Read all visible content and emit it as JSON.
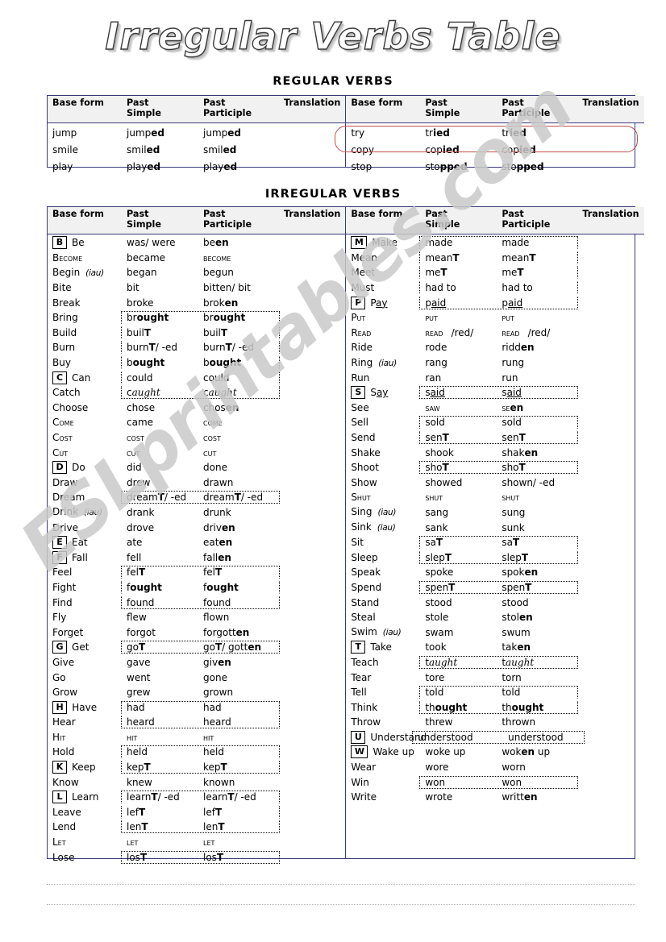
{
  "title": "Irregular Verbs Table",
  "watermark": "ESLprintables.com",
  "headings": {
    "regular": "REGULAR VERBS",
    "irregular": "IRREGULAR VERBS"
  },
  "columns": {
    "base": "Base form",
    "past_simple": "Past\nSimple",
    "past_participle": "Past\nParticiple",
    "translation": "Translation"
  },
  "regular": {
    "left": [
      {
        "base": "jump",
        "ps": "jump",
        "ps_b": "ed",
        "pp": "jump",
        "pp_b": "ed",
        "tr": ""
      },
      {
        "base": "smile",
        "ps": "smil",
        "ps_b": "ed",
        "pp": "smil",
        "pp_b": "ed",
        "tr": ""
      },
      {
        "base": "play",
        "ps": "play",
        "ps_b": "ed",
        "pp": "play",
        "pp_b": "ed",
        "tr": ""
      }
    ],
    "right": [
      {
        "base": "try",
        "ps": "tr",
        "ps_b": "ied",
        "pp": "tr",
        "pp_b": "ied",
        "tr": ""
      },
      {
        "base": "copy",
        "ps": "cop",
        "ps_b": "ied",
        "pp": "cop",
        "pp_b": "ied",
        "tr": ""
      },
      {
        "base": "stop",
        "ps": "sto",
        "ps_b": "pped",
        "pp": "sto",
        "pp_b": "pped",
        "tr": ""
      }
    ],
    "highlight_color": "#c0504d"
  },
  "irregular": {
    "left": [
      {
        "letter": "B",
        "base": "Be",
        "ps": "was/ were",
        "pp": "be",
        "pp_b": "en"
      },
      {
        "base": "Become",
        "base_sc": true,
        "ps": "became",
        "pp": "become",
        "pp_sc": true
      },
      {
        "base": "Begin",
        "note": "(iau)",
        "ps": "began",
        "pp": "begun"
      },
      {
        "base": "Bite",
        "ps": "bit",
        "pp": "bitten/ bit"
      },
      {
        "base": "Break",
        "ps": "broke",
        "pp": "brok",
        "pp_b": "en"
      },
      {
        "base": "Bring",
        "box": "top",
        "ps": "br",
        "ps_b2": "ought",
        "pp": "br",
        "pp_b2": "ought"
      },
      {
        "base": "Build",
        "box": "mid",
        "ps": "buil",
        "ps_b": "T",
        "pp": "buil",
        "pp_b": "T"
      },
      {
        "base": "Burn",
        "box": "mid",
        "ps": "burn",
        "ps_b": "T",
        "ps_tail": "/ -ed",
        "pp": "burn",
        "pp_b": "T",
        "pp_tail": "/ -ed"
      },
      {
        "base": "Buy",
        "box": "mid",
        "ps": "b",
        "ps_b2": "ought",
        "pp": "b",
        "pp_b2": "ought"
      },
      {
        "letter": "C",
        "base": "Can",
        "box": "mid",
        "ps": "could",
        "pp": "could"
      },
      {
        "base": "Catch",
        "box": "bottom",
        "ps": "c",
        "ps_script": "aught",
        "pp": "c",
        "pp_script": "aught"
      },
      {
        "base": "Choose",
        "ps": "chose",
        "pp": "chos",
        "pp_b": "en"
      },
      {
        "base": "Come",
        "base_sc": true,
        "ps": "came",
        "pp": "come",
        "pp_sc": true
      },
      {
        "base": "Cost",
        "base_sc": true,
        "ps": "cost",
        "ps_sc": true,
        "pp": "cost",
        "pp_sc": true
      },
      {
        "base": "Cut",
        "base_sc": true,
        "ps": "cut",
        "ps_sc": true,
        "pp": "cut",
        "pp_sc": true
      },
      {
        "letter": "D",
        "base": "Do",
        "ps": "did",
        "pp": "done"
      },
      {
        "base": "Draw",
        "ps": "drew",
        "pp": "drawn"
      },
      {
        "base": "Dream",
        "box": "single",
        "ps": "dream",
        "ps_b": "T",
        "ps_tail": "/ -ed",
        "pp": "dream",
        "pp_b": "T",
        "pp_tail": "/ -ed"
      },
      {
        "base": "Drink",
        "note": "(iau)",
        "ps": "drank",
        "pp": "drunk"
      },
      {
        "base": "Drive",
        "ps": "drove",
        "pp": "driv",
        "pp_b": "en"
      },
      {
        "letter": "E",
        "base": "Eat",
        "ps": "ate",
        "pp": "eat",
        "pp_b": "en"
      },
      {
        "letter": "F",
        "base": "Fall",
        "ps": "fell",
        "pp": "fall",
        "pp_b": "en"
      },
      {
        "base": "Feel",
        "box": "top",
        "ps": "fel",
        "ps_b": "T",
        "pp": "fel",
        "pp_b": "T"
      },
      {
        "base": "Fight",
        "box": "mid",
        "ps": "f",
        "ps_b2": "ought",
        "pp": "f",
        "pp_b2": "ought"
      },
      {
        "base": "Find",
        "box": "bottom",
        "ps": "found",
        "pp": "found"
      },
      {
        "base": "Fly",
        "ps": "flew",
        "pp": "flown"
      },
      {
        "base": "Forget",
        "ps": "forgot",
        "pp": "forgott",
        "pp_b": "en"
      },
      {
        "letter": "G",
        "base": "Get",
        "box": "single",
        "ps": "go",
        "ps_b": "T",
        "pp": "go",
        "pp_b": "T",
        "pp_tail2": "/ gott",
        "pp_b3": "en"
      },
      {
        "base": "Give",
        "ps": "gave",
        "pp": "giv",
        "pp_b": "en"
      },
      {
        "base": "Go",
        "ps": "went",
        "pp": "gone"
      },
      {
        "base": "Grow",
        "ps": "grew",
        "pp": "grown"
      },
      {
        "letter": "H",
        "base": "Have",
        "box": "top",
        "ps": "had",
        "pp": "had"
      },
      {
        "base": "Hear",
        "box": "bottom",
        "ps": "heard",
        "pp": "heard"
      },
      {
        "base": "Hit",
        "base_sc": true,
        "ps": "hit",
        "ps_sc": true,
        "pp": "hit",
        "pp_sc": true
      },
      {
        "base": "Hold",
        "box": "top",
        "ps": "held",
        "pp": "held"
      },
      {
        "letter": "K",
        "base": "Keep",
        "box": "bottom",
        "ps": "kep",
        "ps_b": "T",
        "pp": "kep",
        "pp_b": "T"
      },
      {
        "base": "Know",
        "ps": "knew",
        "pp": "known"
      },
      {
        "letter": "L",
        "base": "Learn",
        "box": "top",
        "ps": "learn",
        "ps_b": "T",
        "ps_tail": "/ -ed",
        "pp": "learn",
        "pp_b": "T",
        "pp_tail": "/ -ed"
      },
      {
        "base": "Leave",
        "box": "mid",
        "ps": "lef",
        "ps_b": "T",
        "pp": "lef",
        "pp_b": "T"
      },
      {
        "base": "Lend",
        "box": "bottom",
        "ps": "len",
        "ps_b": "T",
        "pp": "len",
        "pp_b": "T"
      },
      {
        "base": "Let",
        "base_sc": true,
        "ps": "let",
        "ps_sc": true,
        "pp": "let",
        "pp_sc": true
      },
      {
        "base": "Lose",
        "box": "single",
        "ps": "los",
        "ps_b": "T",
        "pp": "los",
        "pp_b": "T"
      }
    ],
    "right": [
      {
        "letter": "M",
        "base": "Make",
        "box": "top",
        "ps": "made",
        "pp": "made"
      },
      {
        "base": "Mean",
        "box": "mid",
        "ps": "mean",
        "ps_b": "T",
        "pp": "mean",
        "pp_b": "T"
      },
      {
        "base": "Meet",
        "box": "mid",
        "ps": "me",
        "ps_b": "T",
        "pp": "me",
        "pp_b": "T"
      },
      {
        "base": "Must",
        "box": "mid",
        "ps": "had to",
        "pp": "had to"
      },
      {
        "letter": "P",
        "base": "Pay",
        "base_ul": "ay",
        "box": "bottom",
        "ps": "p",
        "ps_ul": "aid",
        "pp": "p",
        "pp_ul": "aid"
      },
      {
        "base": "Put",
        "base_sc": true,
        "ps": "put",
        "ps_sc": true,
        "pp": "put",
        "pp_sc": true
      },
      {
        "base": "Read",
        "base_sc": true,
        "ps": "read",
        "ps_sc": true,
        "ps_tail3": "/red/",
        "pp": "read",
        "pp_sc": true,
        "pp_tail3": "/red/"
      },
      {
        "base": "Ride",
        "ps": "rode",
        "pp": "ridd",
        "pp_b": "en"
      },
      {
        "base": "Ring",
        "note": "(iau)",
        "ps": "rang",
        "pp": "rung"
      },
      {
        "base": "Run",
        "ps": "ran",
        "pp": "run"
      },
      {
        "letter": "S",
        "base": "Say",
        "base_ul": "ay",
        "box": "single",
        "ps": "s",
        "ps_ul": "aid",
        "pp": "s",
        "pp_ul": "aid"
      },
      {
        "base": "See",
        "base_sc": false,
        "ps": "saw",
        "ps_sc": true,
        "pp": "se",
        "pp_sc": true,
        "pp_b": "en"
      },
      {
        "base": "Sell",
        "box": "top",
        "ps": "sold",
        "pp": "sold"
      },
      {
        "base": "Send",
        "box": "bottom",
        "ps": "sen",
        "ps_b": "T",
        "pp": "sen",
        "pp_b": "T"
      },
      {
        "base": "Shake",
        "ps": "shook",
        "pp": "shak",
        "pp_b": "en"
      },
      {
        "base": "Shoot",
        "box": "single",
        "ps": "sho",
        "ps_b": "T",
        "pp": "sho",
        "pp_b": "T"
      },
      {
        "base": "Show",
        "ps": "showed",
        "pp": "shown/ -ed"
      },
      {
        "base": "Shut",
        "base_sc": true,
        "ps": "shut",
        "ps_sc": true,
        "pp": "shut",
        "pp_sc": true
      },
      {
        "base": "Sing",
        "note": "(iau)",
        "ps": "sang",
        "pp": "sung"
      },
      {
        "base": "Sink",
        "note": "(iau)",
        "ps": "sank",
        "pp": "sunk"
      },
      {
        "base": "Sit",
        "box": "top",
        "ps": "sa",
        "ps_b": "T",
        "pp": "sa",
        "pp_b": "T"
      },
      {
        "base": "Sleep",
        "box": "bottom",
        "ps": "slep",
        "ps_b": "T",
        "pp": "slep",
        "pp_b": "T"
      },
      {
        "base": "Speak",
        "ps": "spoke",
        "pp": "spok",
        "pp_b": "en"
      },
      {
        "base": "Spend",
        "box": "single",
        "ps": "spen",
        "ps_b": "T",
        "pp": "spen",
        "pp_b": "T"
      },
      {
        "base": "Stand",
        "ps": "stood",
        "pp": "stood"
      },
      {
        "base": "Steal",
        "ps": "stole",
        "pp": "stol",
        "pp_b": "en"
      },
      {
        "base": "Swim",
        "note": "(iau)",
        "ps": "swam",
        "pp": "swum"
      },
      {
        "letter": "T",
        "base": "Take",
        "ps": "took",
        "pp": "tak",
        "pp_b": "en"
      },
      {
        "base": "Teach",
        "box": "single",
        "ps": "t",
        "ps_script": "aught",
        "pp": "t",
        "pp_script": "aught"
      },
      {
        "base": "Tear",
        "ps": "tore",
        "pp": "torn"
      },
      {
        "base": "Tell",
        "box": "top",
        "ps": "told",
        "pp": "told"
      },
      {
        "base": "Think",
        "box": "bottom",
        "ps": "th",
        "ps_b2": "ought",
        "pp": "th",
        "pp_b2": "ought"
      },
      {
        "base": "Throw",
        "ps": "threw",
        "pp": "thrown"
      },
      {
        "letter": "U",
        "base": "Understand",
        "box": "wide",
        "ps": "understood",
        "pp": "understood"
      },
      {
        "letter": "W",
        "base": "Wake up",
        "ps": "woke up",
        "pp": "wok",
        "pp_b": "en",
        "pp_tail": " up"
      },
      {
        "base": "Wear",
        "ps": "wore",
        "pp": "worn"
      },
      {
        "base": "Win",
        "box": "single",
        "ps": "won",
        "pp": "won"
      },
      {
        "base": "Write",
        "ps": "wrote",
        "pp": "writt",
        "pp_b": "en"
      }
    ]
  },
  "colors": {
    "table_border": "#3b3b7a",
    "header_bg": "#f1f1f1",
    "highlight": "#c0504d",
    "watermark": "#c9c9c9"
  }
}
